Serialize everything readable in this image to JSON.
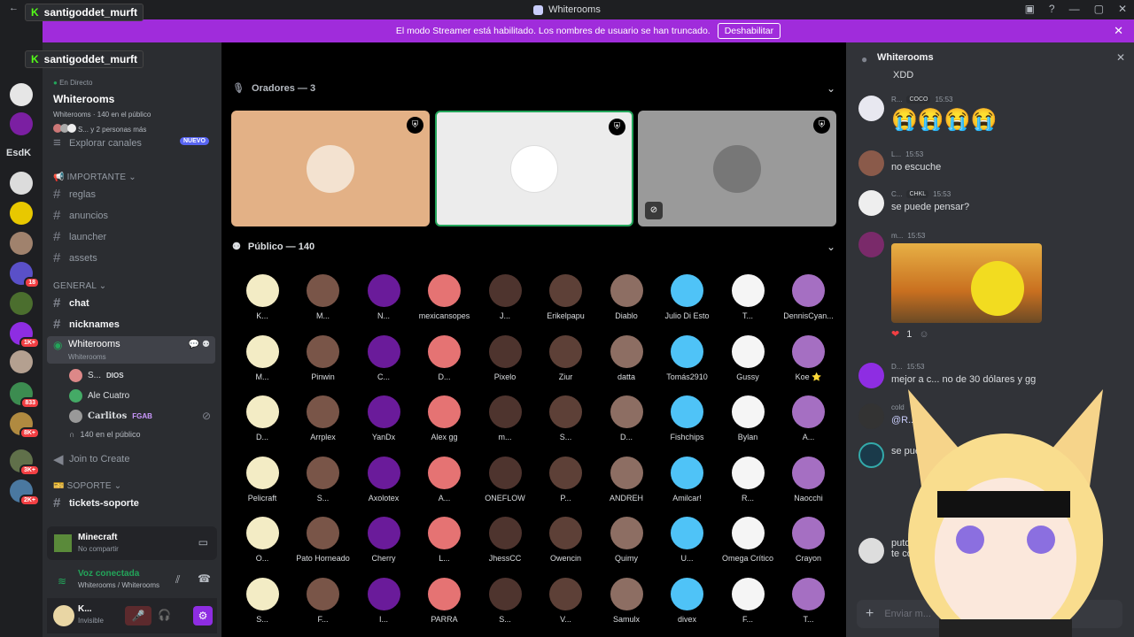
{
  "window": {
    "title": "Whiterooms"
  },
  "banner": {
    "text": "El modo Streamer está habilitado. Los nombres de usuario se han truncado.",
    "button": "Deshabilitar"
  },
  "overlay": {
    "user1": "santigoddet_murft",
    "user2": "santigoddet_murft"
  },
  "servers": {
    "esdk": "EsdK",
    "badges": [
      "18",
      "1K+",
      "833",
      "8K+",
      "3K+",
      "2K+"
    ]
  },
  "sidebar": {
    "live": "En Directo",
    "event_title": "Whiterooms",
    "event_sub": "Whiterooms · 140 en el público",
    "event_people": "S... y 2 personas más",
    "explore": "Explorar canales",
    "new_badge": "NUEVO",
    "cat_important": "IMPORTANTE",
    "ch_reglas": "reglas",
    "ch_anuncios": "anuncios",
    "ch_launcher": "launcher",
    "ch_assets": "assets",
    "cat_general": "GENERAL",
    "ch_chat": "chat",
    "ch_nicknames": "nicknames",
    "stage_name": "Whiterooms",
    "stage_sub": "Whiterooms",
    "vusers": [
      {
        "name": "S...",
        "tag": "DIOS"
      },
      {
        "name": "Ale Cuatro",
        "tag": ""
      },
      {
        "name": "Carlitos",
        "tag": "FGAB"
      }
    ],
    "audience": "140 en el público",
    "join": "Join to Create",
    "cat_support": "SOPORTE",
    "ch_tickets": "tickets-soporte"
  },
  "activity": {
    "game": "Minecraft",
    "sub": "No compartir"
  },
  "voice": {
    "status": "Voz conectada",
    "where": "Whiterooms / Whiterooms"
  },
  "userbar": {
    "name": "K...",
    "status": "Invisible"
  },
  "stage": {
    "speakers_header": "Oradores — 3",
    "audience_header": "Público — 140",
    "audience": [
      "K...",
      "M...",
      "N...",
      "mexicansopes",
      "J...",
      "Erikelpapu",
      "Diablo",
      "Julio Di Esto",
      "T...",
      "DennisCyan...",
      "M...",
      "Pinwin",
      "C...",
      "D...",
      "Pixelo",
      "Ziur",
      "datta",
      "Tomás2910",
      "Gussy",
      "Koe ⭐",
      "D...",
      "Arrplex",
      "YanDx",
      "Alex gg",
      "m...",
      "S...",
      "D...",
      "Fishchips",
      "Bylan",
      "A...",
      "Pelicraft",
      "S...",
      "Axolotex",
      "A...",
      "ONEFLOW",
      "P...",
      "ANDREH",
      "Amilcar!",
      "R...",
      "Naocchi",
      "O...",
      "Pato Horneado",
      "Cherry",
      "L...",
      "JhessCC",
      "Owencin",
      "Quimy",
      "U...",
      "Omega Crítico",
      "Crayon",
      "S...",
      "F...",
      "I...",
      "PARRA",
      "S...",
      "V...",
      "Samulx",
      "divex",
      "F...",
      "T..."
    ]
  },
  "chat": {
    "title": "Whiterooms",
    "messages": [
      {
        "name": "",
        "tag": "",
        "time": "",
        "text": "XDD"
      },
      {
        "name": "R...",
        "tag": "COCO",
        "time": "15:53",
        "text": "😭😭😭😭"
      },
      {
        "name": "L...",
        "tag": "",
        "time": "15:53",
        "text": "no escuche"
      },
      {
        "name": "C...",
        "tag": "CHKL",
        "time": "15:53",
        "text": "se puede pensar?"
      },
      {
        "name": "m...",
        "tag": "",
        "time": "15:53",
        "text": ""
      },
      {
        "name": "D...",
        "tag": "",
        "time": "15:53",
        "text": "mejor a c... no de 30 dólares y gg"
      },
      {
        "name": "cold",
        "tag": "",
        "time": "",
        "text": "@R..."
      },
      {
        "name": "",
        "tag": "",
        "time": "",
        "text": "se pued..."
      },
      {
        "name": "",
        "tag": "",
        "time": "",
        "text": "puto"
      },
      {
        "name": "",
        "tag": "",
        "time": "",
        "text": "te co..."
      }
    ],
    "reaction_count": "1",
    "input_placeholder": "Enviar m..."
  },
  "colors": {
    "accent": "#a02cdb",
    "green": "#23a55a",
    "bg": "#000000"
  }
}
